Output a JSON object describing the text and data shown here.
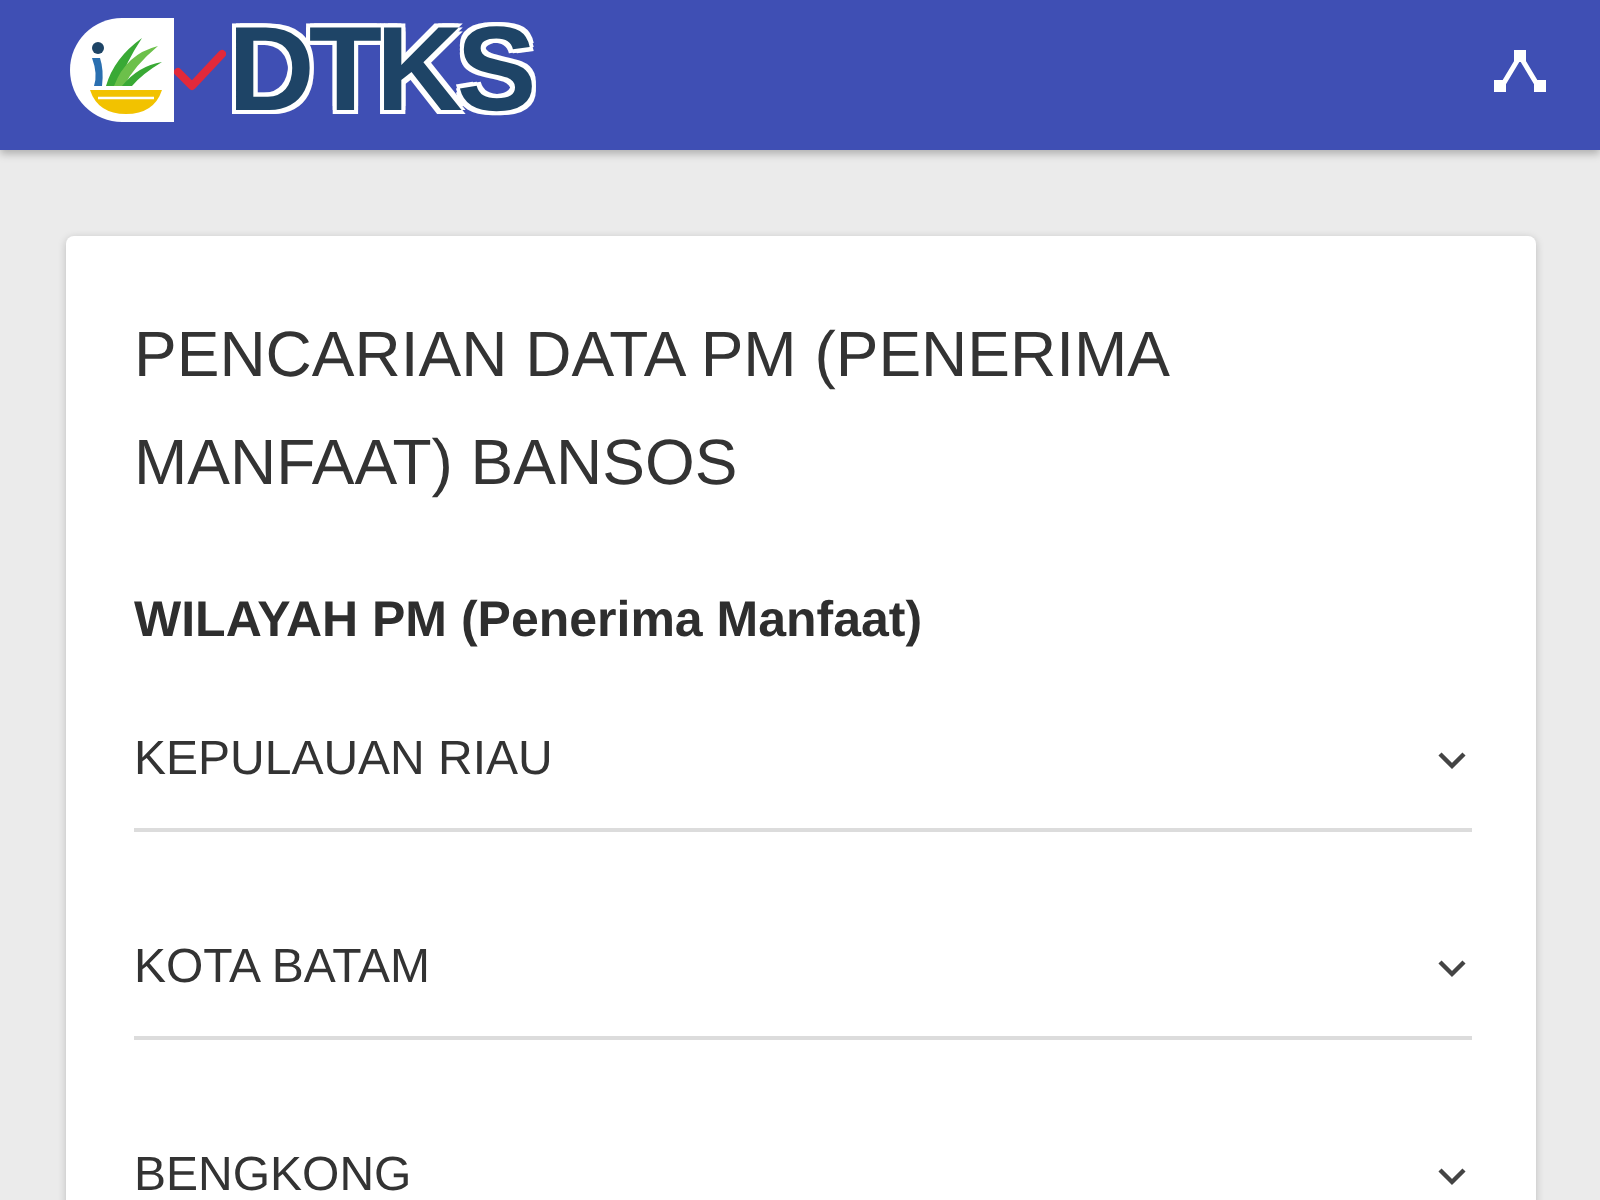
{
  "header": {
    "logo": {
      "text": "DTKS"
    }
  },
  "card": {
    "title": "PENCARIAN DATA PM (PENERIMA MANFAAT) BANSOS",
    "section_label": "WILAYAH PM (Penerima Manfaat)",
    "selects": [
      {
        "value": "KEPULAUAN RIAU"
      },
      {
        "value": "KOTA BATAM"
      },
      {
        "value": "BENGKONG"
      }
    ]
  }
}
